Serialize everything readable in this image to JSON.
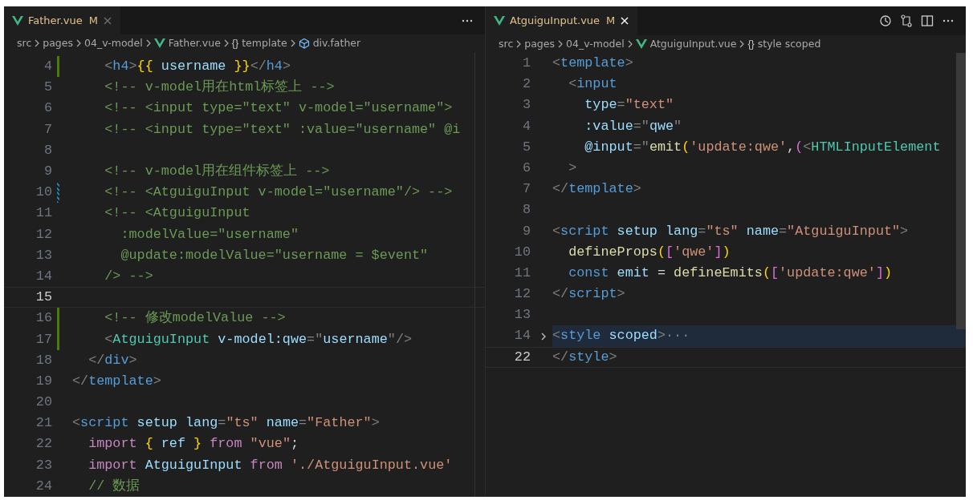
{
  "panes": [
    {
      "focused": false,
      "tab": {
        "label": "Father.vue",
        "status": "M"
      },
      "actions": [
        {
          "kind": "more"
        }
      ],
      "breadcrumb": [
        {
          "label": "src",
          "kind": "folder"
        },
        {
          "label": "pages",
          "kind": "folder"
        },
        {
          "label": "04_v-model",
          "kind": "folder"
        },
        {
          "label": "Father.vue",
          "kind": "vue"
        },
        {
          "label": "template",
          "kind": "braces",
          "symbol": "{}"
        },
        {
          "label": "div.father",
          "kind": "element"
        }
      ],
      "lines": [
        {
          "num": "4",
          "current": false,
          "kind": "added",
          "tokens": [
            {
              "kind": "p",
              "text": "    <"
            },
            {
              "kind": "tag",
              "text": "h4"
            },
            {
              "kind": "p",
              "text": ">"
            },
            {
              "kind": "br",
              "text": "{{"
            },
            {
              "kind": "var",
              "text": " username "
            },
            {
              "kind": "br",
              "text": "}}"
            },
            {
              "kind": "p",
              "text": "</"
            },
            {
              "kind": "tag",
              "text": "h4"
            },
            {
              "kind": "p",
              "text": ">"
            }
          ]
        },
        {
          "num": "5",
          "current": false,
          "kind": "plain",
          "tokens": [
            {
              "kind": "cm",
              "text": "    <!-- v-model用在html标签上 -->"
            }
          ]
        },
        {
          "num": "6",
          "current": false,
          "kind": "plain",
          "tokens": [
            {
              "kind": "cm",
              "text": "    <!-- <input type=\"text\" v-model=\"username\">"
            }
          ]
        },
        {
          "num": "7",
          "current": false,
          "kind": "plain",
          "tokens": [
            {
              "kind": "cm",
              "text": "    <!-- <input type=\"text\" :value=\"username\" @i"
            }
          ]
        },
        {
          "num": "8",
          "current": false,
          "kind": "plain"
        },
        {
          "num": "9",
          "current": false,
          "kind": "plain",
          "tokens": [
            {
              "kind": "cm",
              "text": "    <!-- v-model用在组件标签上 -->"
            }
          ]
        },
        {
          "num": "10",
          "current": false,
          "kind": "modified",
          "tokens": [
            {
              "kind": "cm",
              "text": "    <!-- <AtguiguInput v-model=\"username\"/> -->"
            }
          ]
        },
        {
          "num": "11",
          "current": false,
          "kind": "plain",
          "tokens": [
            {
              "kind": "cm",
              "text": "    <!-- <AtguiguInput"
            }
          ]
        },
        {
          "num": "12",
          "current": false,
          "kind": "plain",
          "tokens": [
            {
              "kind": "cm",
              "text": "      :modelValue=\"username\""
            }
          ]
        },
        {
          "num": "13",
          "current": false,
          "kind": "plain",
          "tokens": [
            {
              "kind": "cm",
              "text": "      @update:modelValue=\"username = $event\""
            }
          ]
        },
        {
          "num": "14",
          "current": false,
          "kind": "plain",
          "tokens": [
            {
              "kind": "cm",
              "text": "    /> -->"
            }
          ]
        },
        {
          "num": "15",
          "current": true,
          "kind": "plain"
        },
        {
          "num": "16",
          "current": false,
          "kind": "added",
          "tokens": [
            {
              "kind": "cm",
              "text": "    <!-- 修改modelValue -->"
            }
          ]
        },
        {
          "num": "17",
          "current": false,
          "kind": "added",
          "tokens": [
            {
              "kind": "p",
              "text": "    <"
            },
            {
              "kind": "comp",
              "text": "AtguiguInput"
            },
            {
              "kind": "attr",
              "text": " v-model:qwe"
            },
            {
              "kind": "p",
              "text": "=\""
            },
            {
              "kind": "var",
              "text": "username"
            },
            {
              "kind": "p",
              "text": "\"/>"
            }
          ]
        },
        {
          "num": "18",
          "current": false,
          "kind": "plain",
          "tokens": [
            {
              "kind": "p",
              "text": "  </"
            },
            {
              "kind": "tag",
              "text": "div"
            },
            {
              "kind": "p",
              "text": ">"
            }
          ]
        },
        {
          "num": "19",
          "current": false,
          "kind": "plain",
          "tokens": [
            {
              "kind": "p",
              "text": "</"
            },
            {
              "kind": "tag",
              "text": "template"
            },
            {
              "kind": "p",
              "text": ">"
            }
          ]
        },
        {
          "num": "20",
          "current": false,
          "kind": "plain"
        },
        {
          "num": "21",
          "current": false,
          "kind": "plain",
          "tokens": [
            {
              "kind": "p",
              "text": "<"
            },
            {
              "kind": "tag",
              "text": "script"
            },
            {
              "kind": "attr",
              "text": " setup lang"
            },
            {
              "kind": "p",
              "text": "="
            },
            {
              "kind": "str",
              "text": "\"ts\""
            },
            {
              "kind": "attr",
              "text": " name"
            },
            {
              "kind": "p",
              "text": "="
            },
            {
              "kind": "str",
              "text": "\"Father\""
            },
            {
              "kind": "p",
              "text": ">"
            }
          ]
        },
        {
          "num": "22",
          "current": false,
          "kind": "plain",
          "tokens": [
            {
              "kind": "kw",
              "text": "  import "
            },
            {
              "kind": "br",
              "text": "{"
            },
            {
              "kind": "var",
              "text": " ref "
            },
            {
              "kind": "br",
              "text": "}"
            },
            {
              "kind": "kw",
              "text": " from "
            },
            {
              "kind": "str",
              "text": "\"vue\""
            },
            {
              "kind": "pl",
              "text": ";"
            }
          ]
        },
        {
          "num": "23",
          "current": false,
          "kind": "plain",
          "tokens": [
            {
              "kind": "kw",
              "text": "  import "
            },
            {
              "kind": "var",
              "text": "AtguiguInput"
            },
            {
              "kind": "kw",
              "text": " from "
            },
            {
              "kind": "str",
              "text": "'./AtguiguInput.vue'"
            }
          ]
        },
        {
          "num": "24",
          "current": false,
          "kind": "plain",
          "tokens": [
            {
              "kind": "cm",
              "text": "  // 数据"
            }
          ]
        }
      ]
    },
    {
      "focused": true,
      "tab": {
        "label": "AtguiguInput.vue",
        "status": "M"
      },
      "actions": [
        {
          "kind": "history"
        },
        {
          "kind": "compare"
        },
        {
          "kind": "split"
        },
        {
          "kind": "more"
        }
      ],
      "breadcrumb": [
        {
          "label": "src",
          "kind": "folder"
        },
        {
          "label": "pages",
          "kind": "folder"
        },
        {
          "label": "04_v-model",
          "kind": "folder"
        },
        {
          "label": "AtguiguInput.vue",
          "kind": "vue"
        },
        {
          "label": "style scoped",
          "kind": "braces",
          "symbol": "{}"
        }
      ],
      "lines": [
        {
          "num": "1",
          "current": false,
          "kind": "plain",
          "tokens": [
            {
              "kind": "p",
              "text": "<"
            },
            {
              "kind": "tag",
              "text": "template"
            },
            {
              "kind": "p",
              "text": ">"
            }
          ]
        },
        {
          "num": "2",
          "current": false,
          "kind": "plain",
          "tokens": [
            {
              "kind": "p",
              "text": "  <"
            },
            {
              "kind": "tag",
              "text": "input"
            }
          ]
        },
        {
          "num": "3",
          "current": false,
          "kind": "plain",
          "tokens": [
            {
              "kind": "attr",
              "text": "    type"
            },
            {
              "kind": "p",
              "text": "="
            },
            {
              "kind": "str",
              "text": "\"text\""
            }
          ]
        },
        {
          "num": "4",
          "current": false,
          "kind": "plain",
          "tokens": [
            {
              "kind": "attr",
              "text": "    :value"
            },
            {
              "kind": "p",
              "text": "=\""
            },
            {
              "kind": "var",
              "text": "qwe"
            },
            {
              "kind": "p",
              "text": "\""
            }
          ]
        },
        {
          "num": "5",
          "current": false,
          "kind": "plain",
          "tokens": [
            {
              "kind": "attr",
              "text": "    @input"
            },
            {
              "kind": "p",
              "text": "=\""
            },
            {
              "kind": "fn",
              "text": "emit"
            },
            {
              "kind": "br",
              "text": "("
            },
            {
              "kind": "str",
              "text": "'update:qwe'"
            },
            {
              "kind": "pl",
              "text": ","
            },
            {
              "kind": "br2",
              "text": "("
            },
            {
              "kind": "p",
              "text": "<"
            },
            {
              "kind": "comp",
              "text": "HTMLInputElement"
            }
          ]
        },
        {
          "num": "6",
          "current": false,
          "kind": "plain",
          "tokens": [
            {
              "kind": "p",
              "text": "  >"
            }
          ]
        },
        {
          "num": "7",
          "current": false,
          "kind": "plain",
          "tokens": [
            {
              "kind": "p",
              "text": "</"
            },
            {
              "kind": "tag",
              "text": "template"
            },
            {
              "kind": "p",
              "text": ">"
            }
          ]
        },
        {
          "num": "8",
          "current": false,
          "kind": "plain"
        },
        {
          "num": "9",
          "current": false,
          "kind": "plain",
          "tokens": [
            {
              "kind": "p",
              "text": "<"
            },
            {
              "kind": "tag",
              "text": "script"
            },
            {
              "kind": "attr",
              "text": " setup lang"
            },
            {
              "kind": "p",
              "text": "="
            },
            {
              "kind": "str",
              "text": "\"ts\""
            },
            {
              "kind": "attr",
              "text": " name"
            },
            {
              "kind": "p",
              "text": "="
            },
            {
              "kind": "str",
              "text": "\"AtguiguInput\""
            },
            {
              "kind": "p",
              "text": ">"
            }
          ]
        },
        {
          "num": "10",
          "current": false,
          "kind": "plain",
          "tokens": [
            {
              "kind": "fn",
              "text": "  defineProps"
            },
            {
              "kind": "br",
              "text": "("
            },
            {
              "kind": "br2",
              "text": "["
            },
            {
              "kind": "str",
              "text": "'qwe'"
            },
            {
              "kind": "br2",
              "text": "]"
            },
            {
              "kind": "br",
              "text": ")"
            }
          ]
        },
        {
          "num": "11",
          "current": false,
          "kind": "plain",
          "tokens": [
            {
              "kind": "stor",
              "text": "  const"
            },
            {
              "kind": "var",
              "text": " emit "
            },
            {
              "kind": "pl",
              "text": "="
            },
            {
              "kind": "fn",
              "text": " defineEmits"
            },
            {
              "kind": "br",
              "text": "("
            },
            {
              "kind": "br2",
              "text": "["
            },
            {
              "kind": "str",
              "text": "'update:qwe'"
            },
            {
              "kind": "br2",
              "text": "]"
            },
            {
              "kind": "br",
              "text": ")"
            }
          ]
        },
        {
          "num": "12",
          "current": false,
          "kind": "plain",
          "tokens": [
            {
              "kind": "p",
              "text": "</"
            },
            {
              "kind": "tag",
              "text": "script"
            },
            {
              "kind": "p",
              "text": ">"
            }
          ]
        },
        {
          "num": "13",
          "current": false,
          "kind": "plain"
        },
        {
          "num": "14",
          "current": false,
          "kind": "folded",
          "tokens": [
            {
              "kind": "p",
              "text": "<"
            },
            {
              "kind": "tag",
              "text": "style"
            },
            {
              "kind": "attr",
              "text": " scoped"
            },
            {
              "kind": "p",
              "text": ">"
            },
            {
              "kind": "p",
              "text": "···"
            }
          ]
        },
        {
          "num": "22",
          "current": true,
          "kind": "plain",
          "tokens": [
            {
              "kind": "p",
              "text": "</"
            },
            {
              "kind": "tag",
              "text": "style"
            },
            {
              "kind": "p",
              "text": ">"
            }
          ]
        }
      ]
    }
  ]
}
